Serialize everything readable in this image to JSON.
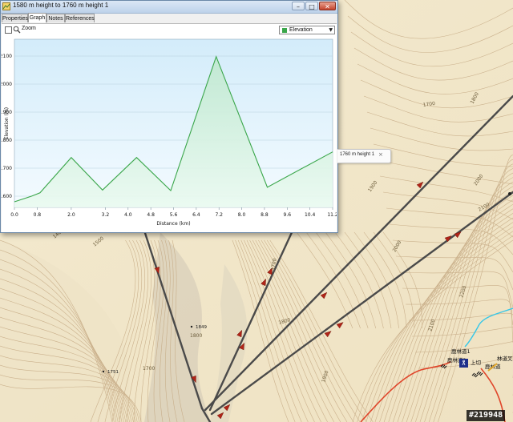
{
  "window": {
    "title": "1580 m height to 1760 m height 1",
    "buttons": {
      "minimize": "–",
      "maximize": "□",
      "close": "✕"
    }
  },
  "tabs": [
    {
      "label": "Properties"
    },
    {
      "label": "Graph",
      "active": true
    },
    {
      "label": "Notes"
    },
    {
      "label": "References"
    }
  ],
  "toolbar": {
    "zoom_label": "Zoom",
    "zoom_checked": false,
    "series_select": "Elevation"
  },
  "tooltip": {
    "text": "1760 m height 1",
    "close": "×"
  },
  "chart_data": {
    "type": "area",
    "title": "",
    "xlabel": "Distance  (km)",
    "ylabel": "Elevation (m)",
    "xlim": [
      0,
      11.2
    ],
    "ylim": [
      1560,
      2160
    ],
    "xticks": [
      0.0,
      0.8,
      2.0,
      3.2,
      4.0,
      4.8,
      5.6,
      6.4,
      7.2,
      8.0,
      8.8,
      9.6,
      10.4,
      11.2
    ],
    "xtick_labels": [
      "0.0",
      "0.8",
      "2.0",
      "3.2",
      "4.0",
      "4.8",
      "5.6",
      "6.4",
      "7.2",
      "8.0",
      "8.8",
      "9.6",
      "10.4",
      "11.2"
    ],
    "yticks": [
      1600,
      1700,
      1800,
      1900,
      2000,
      2100
    ],
    "grid": true,
    "legend": "top-right",
    "series": [
      {
        "name": "Elevation",
        "color": "#3aa64a",
        "x": [
          0.0,
          0.6,
          0.9,
          2.0,
          3.1,
          4.3,
          5.5,
          7.1,
          8.9,
          11.2
        ],
        "y": [
          1580,
          1600,
          1612,
          1738,
          1622,
          1738,
          1620,
          2098,
          1632,
          1758
        ]
      }
    ]
  },
  "map": {
    "contour_labels": [
      {
        "text": "1700",
        "x": 528,
        "y": 133,
        "r": -8
      },
      {
        "text": "1800",
        "x": 590,
        "y": 130,
        "r": -62
      },
      {
        "text": "1900",
        "x": 462,
        "y": 240,
        "r": -55
      },
      {
        "text": "2000",
        "x": 594,
        "y": 232,
        "r": -55
      },
      {
        "text": "2100",
        "x": 598,
        "y": 264,
        "r": -30
      },
      {
        "text": "2000",
        "x": 493,
        "y": 315,
        "r": -60
      },
      {
        "text": "2200",
        "x": 577,
        "y": 372,
        "r": -72
      },
      {
        "text": "2100",
        "x": 538,
        "y": 414,
        "r": -72
      },
      {
        "text": "1900",
        "x": 405,
        "y": 478,
        "r": -72
      },
      {
        "text": "1800",
        "x": 348,
        "y": 405,
        "r": -15
      },
      {
        "text": "1700",
        "x": 342,
        "y": 338,
        "r": -80
      },
      {
        "text": "1400",
        "x": 68,
        "y": 298,
        "r": -40
      },
      {
        "text": "1500",
        "x": 118,
        "y": 308,
        "r": -40
      },
      {
        "text": "1800",
        "x": 237,
        "y": 421,
        "r": 0
      },
      {
        "text": "1700",
        "x": 178,
        "y": 462,
        "r": 0
      }
    ],
    "spot_heights": [
      {
        "text": "1849",
        "x": 244,
        "y": 410
      },
      {
        "text": "1751",
        "x": 134,
        "y": 466
      }
    ],
    "place_labels": [
      {
        "text": "鹿林道1",
        "x": 563,
        "y": 441
      },
      {
        "text": "鹿林道2",
        "x": 558,
        "y": 452
      },
      {
        "text": "上切",
        "x": 587,
        "y": 455
      },
      {
        "text": "林道叉",
        "x": 620,
        "y": 450
      },
      {
        "text": "鹿林道",
        "x": 605,
        "y": 460
      }
    ],
    "colors": {
      "route": "#4a4a4a",
      "arrow": "#b02418",
      "trail": "#e0452a",
      "water": "#37c7e8",
      "contour": "#c4a882"
    }
  },
  "watermark": {
    "text": "#219948"
  }
}
